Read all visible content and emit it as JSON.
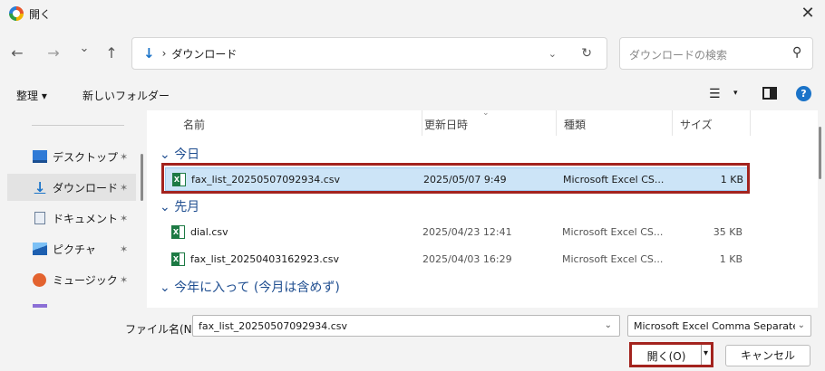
{
  "window": {
    "title": "開く",
    "close_glyph": "✕"
  },
  "nav": {
    "back_glyph": "←",
    "forward_glyph": "→",
    "recent_glyph": "⌄",
    "up_glyph": "↑"
  },
  "address": {
    "location_icon": "↓",
    "separator": "›",
    "path": "ダウンロード",
    "dropdown_glyph": "⌄",
    "refresh_glyph": "↻"
  },
  "search": {
    "placeholder": "ダウンロードの検索",
    "icon_glyph": "⚲"
  },
  "toolbar": {
    "organize": "整理 ▾",
    "new_folder": "新しいフォルダー",
    "view_glyph": "☰",
    "view_chevron": "▾",
    "help_glyph": "?"
  },
  "sidebar": {
    "pin_glyph": "✶",
    "items": [
      {
        "label": "デスクトップ",
        "icon": "desktop-icon"
      },
      {
        "label": "ダウンロード",
        "icon": "download-icon"
      },
      {
        "label": "ドキュメント",
        "icon": "documents-icon"
      },
      {
        "label": "ピクチャ",
        "icon": "pictures-icon"
      },
      {
        "label": "ミュージック",
        "icon": "music-icon"
      }
    ]
  },
  "columns": {
    "name": "名前",
    "modified": "更新日時",
    "type": "種類",
    "size": "サイズ",
    "sort_glyph": "⌄"
  },
  "groups": {
    "today": "今日",
    "last_month": "先月",
    "this_year": "今年に入って (今月は含めず)"
  },
  "files": [
    {
      "name": "fax_list_20250507092934.csv",
      "modified": "2025/05/07 9:49",
      "type": "Microsoft Excel CS...",
      "size": "1 KB",
      "selected": true
    },
    {
      "name": "dial.csv",
      "modified": "2025/04/23 12:41",
      "type": "Microsoft Excel CS...",
      "size": "35 KB"
    },
    {
      "name": "fax_list_20250403162923.csv",
      "modified": "2025/04/03 16:29",
      "type": "Microsoft Excel CS...",
      "size": "1 KB"
    }
  ],
  "file_icon_letter": "X",
  "footer": {
    "filename_label": "ファイル名(N):",
    "filename_value": "fax_list_20250507092934.csv",
    "filetype_value": "Microsoft Excel Comma Separated",
    "dropdown_glyph": "⌄",
    "open_label": "開く(O)",
    "open_arrow": "▾",
    "cancel_label": "キャンセル"
  },
  "colors": {
    "highlight_outline": "#a3231e",
    "selection_bg": "#cce4f7",
    "group_heading": "#1f4e90",
    "excel_green": "#1d7a44",
    "accent_blue": "#1a73c8"
  }
}
